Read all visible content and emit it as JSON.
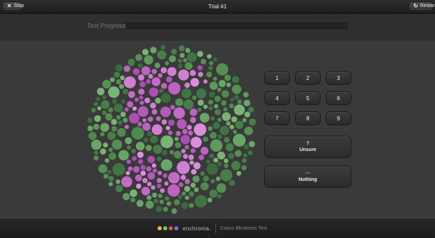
{
  "header": {
    "title": "Trial #1",
    "stop_label": "Stop",
    "restart_label": "Restart"
  },
  "progress": {
    "label": "Test Progress:",
    "fraction": 0
  },
  "plate": {
    "digit": "5",
    "figure_color": "#c46bc8",
    "background_color": "#4e8a4e"
  },
  "keypad": {
    "keys": [
      "1",
      "2",
      "3",
      "4",
      "5",
      "6",
      "7",
      "8",
      "9"
    ]
  },
  "unsure": {
    "icon": "?",
    "label": "Unsure"
  },
  "nothing": {
    "icon": "···",
    "label": "Nothing"
  },
  "footer": {
    "brand": "enchroma.",
    "tagline": "Colour Blindness Test",
    "dot_colors": [
      "#f0b73a",
      "#7fbf6a",
      "#d9534f",
      "#8a6ad6"
    ]
  }
}
